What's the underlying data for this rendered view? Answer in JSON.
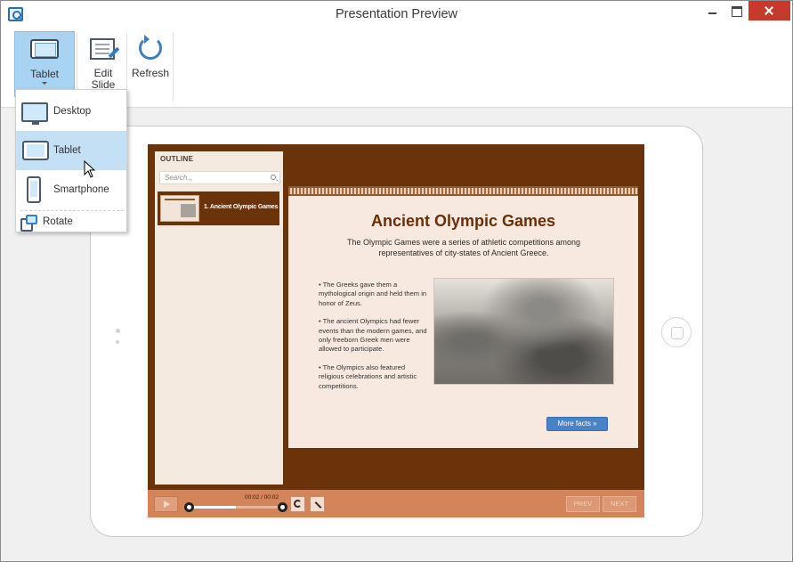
{
  "window": {
    "title": "Presentation Preview"
  },
  "ribbon": {
    "tablet_label": "Tablet",
    "edit_label_line1": "Edit",
    "edit_label_line2": "Slide",
    "refresh_label": "Refresh"
  },
  "menu": {
    "items": [
      {
        "label": "Desktop",
        "icon": "desktop-icon",
        "selected": false
      },
      {
        "label": "Tablet",
        "icon": "tablet-icon",
        "selected": true
      },
      {
        "label": "Smartphone",
        "icon": "smartphone-icon",
        "selected": false
      }
    ],
    "rotate_label": "Rotate"
  },
  "player": {
    "outline_title": "OUTLINE",
    "search_placeholder": "Search...",
    "outline_items": [
      {
        "label": "1. Ancient Olympic Games"
      }
    ],
    "time": "00:02 / 00:02",
    "progress_fraction": 0.5,
    "prev_label": "PREV",
    "next_label": "NEXT"
  },
  "slide": {
    "title": "Ancient Olympic Games",
    "subtitle": "The Olympic Games were a series of athletic competitions among representatives of city-states of Ancient Greece.",
    "bullets": [
      "• The Greeks gave them a mythological origin and held them in honor of Zeus.",
      "• The ancient Olympics had fewer events than the modern games, and only freeborn Greek men were allowed to participate.",
      "• The Olympics also featured religious celebrations and artistic competitions."
    ],
    "button_label": "More facts »"
  },
  "colors": {
    "accent": "#a9d3f2",
    "player_brown": "#6b3309",
    "controls_orange": "#d4845a",
    "slide_title": "#6b2f08",
    "button_blue": "#4a82c8"
  }
}
